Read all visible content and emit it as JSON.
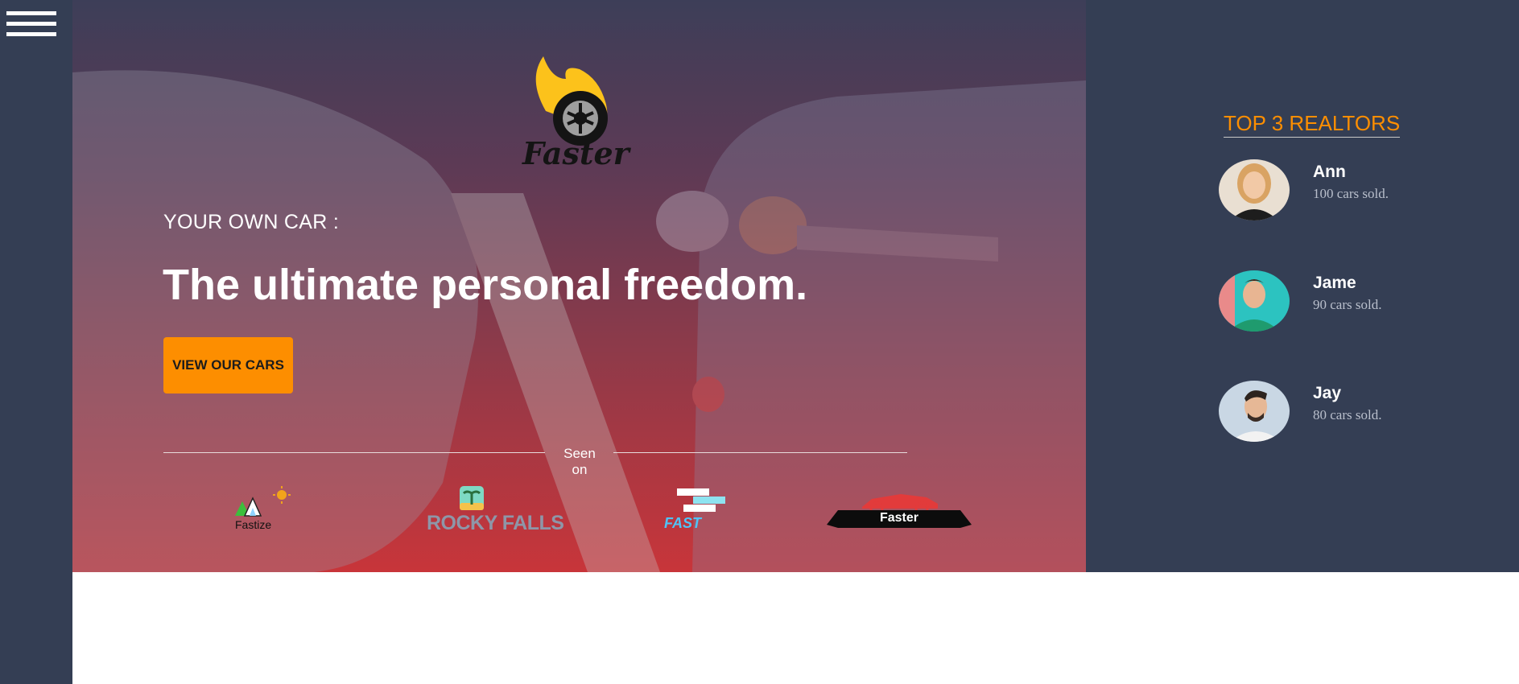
{
  "sidebar": {
    "menu_icon": "hamburger-menu-icon"
  },
  "hero": {
    "logo_text": "Faster",
    "eyebrow": "YOUR OWN CAR :",
    "headline": "The ultimate personal freedom.",
    "cta_label": "VIEW OUR CARS",
    "seen_on_label": "Seen on",
    "brands": [
      "Fastize",
      "ROCKY FALLS",
      "FAST",
      "Faster"
    ]
  },
  "realtors": {
    "title": "TOP 3 REALTORS",
    "items": [
      {
        "name": "Ann",
        "sold": "100 cars sold."
      },
      {
        "name": "Jame",
        "sold": "90 cars sold."
      },
      {
        "name": "Jay",
        "sold": "80 cars sold."
      }
    ]
  },
  "colors": {
    "accent": "#fd8e00",
    "panel": "#343e54",
    "hero_top": "#3d3e58",
    "hero_bottom": "#c8353a"
  }
}
